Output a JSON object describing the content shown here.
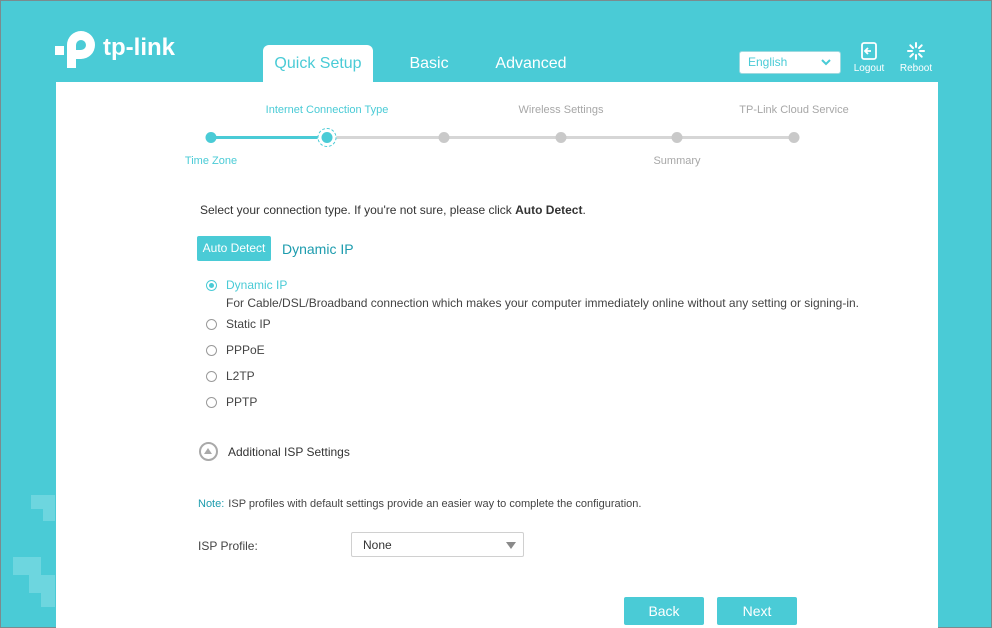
{
  "brand": {
    "name": "tp-link"
  },
  "tabs": [
    {
      "label": "Quick Setup",
      "active": true
    },
    {
      "label": "Basic",
      "active": false
    },
    {
      "label": "Advanced",
      "active": false
    }
  ],
  "header": {
    "language": "English",
    "logout_label": "Logout",
    "reboot_label": "Reboot"
  },
  "progress": {
    "top_labels": [
      "Internet Connection Type",
      "Wireless Settings",
      "TP-Link Cloud Service"
    ],
    "bottom_labels": [
      "Time Zone",
      "Summary"
    ],
    "current_step": 2,
    "total_steps": 6
  },
  "main": {
    "instruction_prefix": "Select your connection type. If you're not sure, please click ",
    "instruction_bold": "Auto Detect",
    "instruction_suffix": ".",
    "auto_detect_label": "Auto Detect",
    "detected_type": "Dynamic IP",
    "options": [
      {
        "label": "Dynamic IP",
        "selected": true
      },
      {
        "label": "Static IP",
        "selected": false
      },
      {
        "label": "PPPoE",
        "selected": false
      },
      {
        "label": "L2TP",
        "selected": false
      },
      {
        "label": "PPTP",
        "selected": false
      }
    ],
    "dynamic_ip_description": "For Cable/DSL/Broadband connection which makes your computer immediately online without any setting or signing-in.",
    "additional_isp_label": "Additional ISP Settings",
    "note_label": "Note:",
    "note_text": "ISP profiles with default settings provide an easier way to complete the configuration.",
    "isp_profile_label": "ISP Profile:",
    "isp_profile_value": "None",
    "back_label": "Back",
    "next_label": "Next"
  },
  "colors": {
    "accent": "#4acbd6",
    "accent_dark": "#1d9cae",
    "inactive": "#c9c9c9"
  }
}
